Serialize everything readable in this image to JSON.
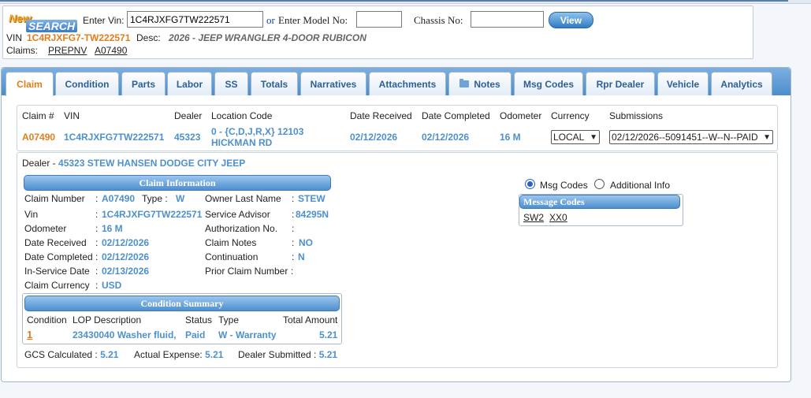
{
  "search": {
    "logo_new": "New",
    "logo_search": "SEARCH",
    "vin_label": "Enter Vin:",
    "vin_value": "1C4RJXFG7TW222571",
    "or_label": "or",
    "model_label": "Enter Model No:",
    "model_value": "",
    "chassis_label": "Chassis No:",
    "chassis_value": "",
    "view_button": "View",
    "vin_caption": "VIN",
    "vin_display": "1C4RJXFG7-TW222571",
    "desc_caption": "Desc:",
    "desc_value": "2026 - JEEP WRANGLER 4-DOOR RUBICON",
    "claims_caption": "Claims:",
    "claims": [
      "PREPNV",
      "A07490"
    ]
  },
  "tabs": [
    {
      "label": "Claim"
    },
    {
      "label": "Condition"
    },
    {
      "label": "Parts"
    },
    {
      "label": "Labor"
    },
    {
      "label": "SS"
    },
    {
      "label": "Totals"
    },
    {
      "label": "Narratives"
    },
    {
      "label": "Attachments"
    },
    {
      "label": "Notes"
    },
    {
      "label": "Msg Codes"
    },
    {
      "label": "Rpr Dealer"
    },
    {
      "label": "Vehicle"
    },
    {
      "label": "Analytics"
    }
  ],
  "claim_row": {
    "headers": {
      "claim": "Claim #",
      "vin": "VIN",
      "dealer": "Dealer",
      "location": "Location Code",
      "received": "Date Received",
      "completed": "Date Completed",
      "odometer": "Odometer",
      "currency": "Currency",
      "submissions": "Submissions"
    },
    "claim": "A07490",
    "vin": "1C4RJXFG7TW222571",
    "dealer": "45323",
    "location_line1": "0 - {C,D,J,R,X} 12103",
    "location_line2": "HICKMAN RD",
    "received": "02/12/2026",
    "completed": "02/12/2026",
    "odometer": "16 M",
    "currency": "LOCAL",
    "submission": "02/12/2026--5091451--W--N--PAID"
  },
  "dealer_line": {
    "label": "Dealer -",
    "value": "45323 STEW HANSEN DODGE CITY JEEP"
  },
  "claim_info": {
    "title": "Claim Information",
    "left": [
      {
        "label": "Claim Number",
        "value": "A07490"
      },
      {
        "label": "Vin",
        "value": "1C4RJXFG7TW222571"
      },
      {
        "label": "Odometer",
        "value": "16 M"
      },
      {
        "label": "Date Received",
        "value": "02/12/2026"
      },
      {
        "label": "Date Completed",
        "value": "02/12/2026"
      },
      {
        "label": "In-Service Date",
        "value": "02/13/2026"
      },
      {
        "label": "Claim Currency",
        "value": "USD"
      }
    ],
    "type_label": "Type :",
    "type_value": "W",
    "right": [
      {
        "label": "Owner Last Name",
        "value": "STEW"
      },
      {
        "label": "Service Advisor",
        "value": "84295N"
      },
      {
        "label": "Authorization No.",
        "value": ""
      },
      {
        "label": "Claim Notes",
        "value": "NO"
      },
      {
        "label": "Continuation",
        "value": "N"
      },
      {
        "label": "Prior Claim Number",
        "value": ""
      }
    ]
  },
  "condition_summary": {
    "title": "Condition Summary",
    "headers": {
      "condition": "Condition",
      "lop": "LOP Description",
      "status": "Status",
      "type": "Type",
      "total": "Total Amount"
    },
    "row": {
      "condition": "1",
      "lop": "23430040 Washer fluid,",
      "status": "Paid",
      "type": "W - Warranty",
      "total": "5.21"
    }
  },
  "totals": {
    "gcs_label": "GCS Calculated :",
    "gcs_value": "5.21",
    "actual_label": "Actual Expense:",
    "actual_value": "5.21",
    "submitted_label": "Dealer Submitted :",
    "submitted_value": "5.21"
  },
  "message_panel": {
    "radio1": "Msg Codes",
    "radio2": "Additional Info",
    "title": "Message Codes",
    "codes": [
      "SW2",
      "XX0"
    ]
  }
}
